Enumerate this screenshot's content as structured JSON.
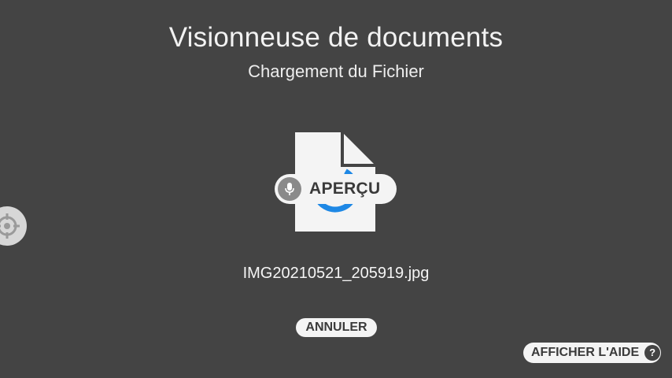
{
  "header": {
    "title": "Visionneuse de documents",
    "subtitle": "Chargement du Fichier"
  },
  "preview": {
    "document_icon": "document-icon",
    "spinner_icon": "loading-spinner-icon",
    "button_icon": "microphone-icon",
    "button_label": "APERÇU"
  },
  "file": {
    "name": "IMG20210521_205919.jpg"
  },
  "actions": {
    "cancel_label": "ANNULER",
    "help_label": "AFFICHER L'AIDE",
    "help_icon_glyph": "?",
    "target_icon": "crosshair-icon"
  },
  "colors": {
    "background": "#444444",
    "pill": "#f4f4f4",
    "spinner": "#1e88e5",
    "text_dark": "#3a3a3a"
  }
}
